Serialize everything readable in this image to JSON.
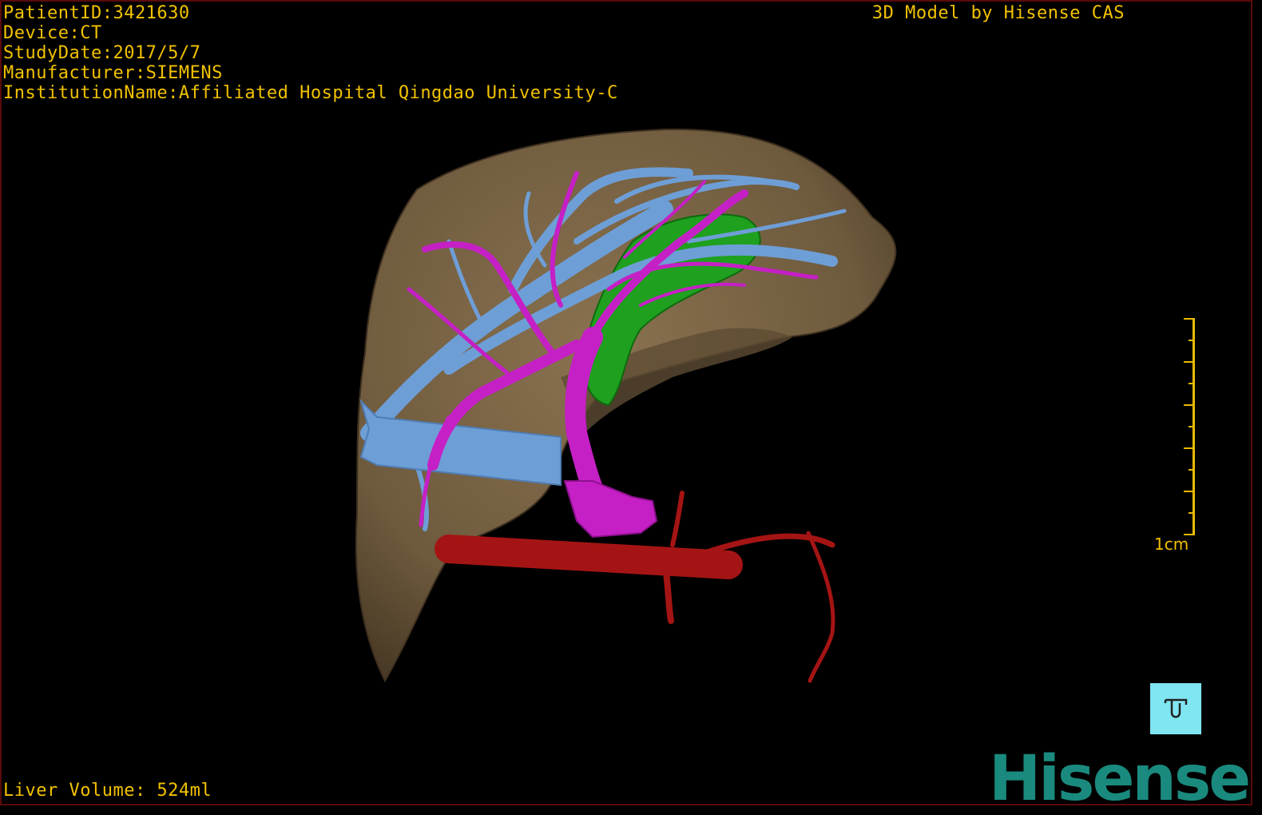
{
  "patient_info": {
    "patient_id": "PatientID:3421630",
    "device": "Device:CT",
    "study_date": "StudyDate:2017/5/7",
    "manufacturer": "Manufacturer:SIEMENS",
    "institution": "InstitutionName:Affiliated Hospital Qingdao University-C"
  },
  "header": {
    "model_credit": "3D Model by Hisense CAS"
  },
  "footer": {
    "liver_volume": "Liver Volume: 524ml"
  },
  "scale_bar": {
    "label": "1cm"
  },
  "logo": {
    "text": "Hisense"
  },
  "icons": {
    "orientation": "orientation-cube-icon"
  },
  "colors": {
    "overlay_text": "#f2c200",
    "liver": "#7a6445",
    "portal_vein": "#c520c5",
    "hepatic_vein": "#6e9ed6",
    "gallbladder": "#1fa01f",
    "artery": "#a51414",
    "logo": "#1a8a7e",
    "cube": "#7fe6f2"
  }
}
